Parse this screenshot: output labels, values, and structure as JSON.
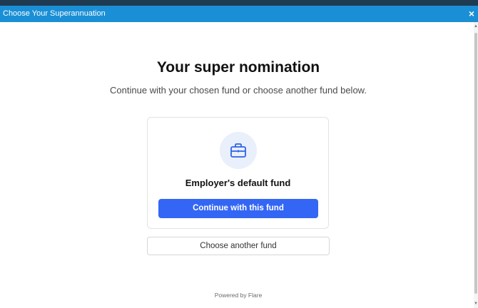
{
  "window": {
    "title": "Choose Your Superannuation",
    "close_glyph": "×"
  },
  "main": {
    "heading": "Your super nomination",
    "subtitle": "Continue with your chosen fund or choose another fund below."
  },
  "card": {
    "icon": "briefcase-icon",
    "label": "Employer's default fund",
    "continue_label": "Continue with this fund"
  },
  "choose_another_label": "Choose another fund",
  "footer": {
    "powered_by": "Powered by Flare"
  },
  "colors": {
    "titlebar": "#1a8fd6",
    "primary": "#3366f5",
    "icon_bg": "#e9effb"
  }
}
